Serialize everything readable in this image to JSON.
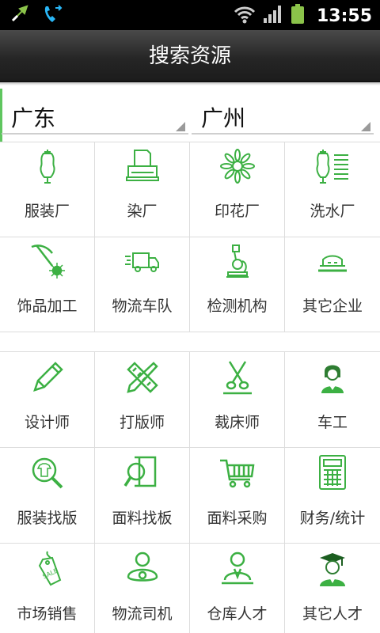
{
  "status_bar": {
    "time": "13:55",
    "icons": [
      "usb-icon",
      "phone-forward-icon",
      "wifi-icon",
      "signal-icon",
      "battery-icon"
    ]
  },
  "header": {
    "title": "搜索资源"
  },
  "location": {
    "province": "广东",
    "city": "广州"
  },
  "enterprises": [
    {
      "label": "服装厂",
      "icon": "dress-form-icon"
    },
    {
      "label": "染厂",
      "icon": "printer-icon"
    },
    {
      "label": "印花厂",
      "icon": "flower-icon"
    },
    {
      "label": "洗水厂",
      "icon": "dress-form-lines-icon"
    },
    {
      "label": "饰品加工",
      "icon": "pickaxe-icon"
    },
    {
      "label": "物流车队",
      "icon": "truck-icon"
    },
    {
      "label": "检测机构",
      "icon": "microscope-icon"
    },
    {
      "label": "其它企业",
      "icon": "building-icon"
    }
  ],
  "talents": [
    {
      "label": "设计师",
      "icon": "pencil-icon"
    },
    {
      "label": "打版师",
      "icon": "ruler-pencil-icon"
    },
    {
      "label": "裁床师",
      "icon": "scissors-icon"
    },
    {
      "label": "车工",
      "icon": "worker-icon"
    },
    {
      "label": "服装找版",
      "icon": "shirt-search-icon"
    },
    {
      "label": "面料找板",
      "icon": "fabric-search-icon"
    },
    {
      "label": "面料采购",
      "icon": "cart-icon"
    },
    {
      "label": "财务/统计",
      "icon": "calculator-icon"
    },
    {
      "label": "市场销售",
      "icon": "sale-tag-icon"
    },
    {
      "label": "物流司机",
      "icon": "driver-icon"
    },
    {
      "label": "仓库人才",
      "icon": "warehouse-person-icon"
    },
    {
      "label": "其它人才",
      "icon": "graduate-icon"
    }
  ],
  "colors": {
    "accent": "#3cb043",
    "title_bar": "#262626",
    "status_bar": "#000000"
  }
}
